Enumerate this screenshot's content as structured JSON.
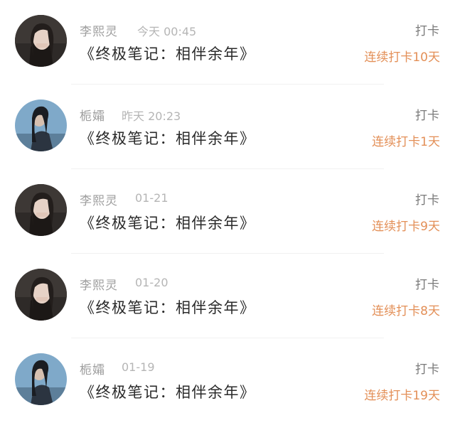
{
  "feed": [
    {
      "name": "李熙灵",
      "time": "今天 00:45",
      "title": "《终极笔记：相伴余年》",
      "action": "打卡",
      "streak": "连续打卡10天",
      "avatar_icon": "user-avatar-woman-dark"
    },
    {
      "name": "栀孀",
      "time": "昨天 20:23",
      "title": "《终极笔记：相伴余年》",
      "action": "打卡",
      "streak": "连续打卡1天",
      "avatar_icon": "user-avatar-woman-sky"
    },
    {
      "name": "李熙灵",
      "time": "01-21",
      "title": "《终极笔记：相伴余年》",
      "action": "打卡",
      "streak": "连续打卡9天",
      "avatar_icon": "user-avatar-woman-dark"
    },
    {
      "name": "李熙灵",
      "time": "01-20",
      "title": "《终极笔记：相伴余年》",
      "action": "打卡",
      "streak": "连续打卡8天",
      "avatar_icon": "user-avatar-woman-dark"
    },
    {
      "name": "栀孀",
      "time": "01-19",
      "title": "《终极笔记：相伴余年》",
      "action": "打卡",
      "streak": "连续打卡19天",
      "avatar_icon": "user-avatar-woman-sky"
    }
  ],
  "colors": {
    "streak": "#e38f57",
    "name": "#9e9e9e",
    "time": "#b5b5b5",
    "action": "#7a7a7a"
  }
}
